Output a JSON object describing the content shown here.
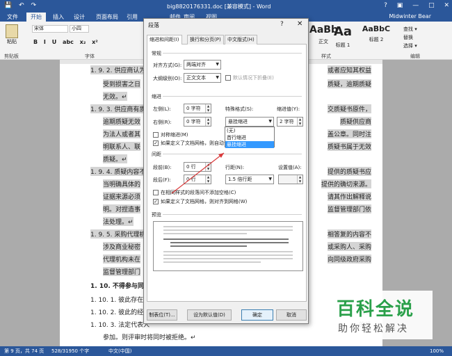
{
  "window": {
    "title": "big8820176331.doc [兼容模式] - Word",
    "quick_access": [
      "💾",
      "↶",
      "↷"
    ],
    "controls": [
      "?",
      "▣",
      "—",
      "□",
      "✕"
    ],
    "user": "Midwinter Bear"
  },
  "ribbon": {
    "file_tab": "文件",
    "tabs": [
      "开始",
      "插入",
      "设计",
      "页面布局",
      "引用",
      "邮件",
      "审阅",
      "视图"
    ],
    "active_tab": "开始",
    "paste_label": "粘贴",
    "clipboard_label": "剪贴板",
    "font_name": "宋体",
    "font_size": "小四",
    "font_group_label": "字体",
    "format_buttons": [
      "B",
      "I",
      "U",
      "abc",
      "x₂",
      "x²"
    ],
    "styles_group_label": "样式",
    "styles": [
      {
        "preview": "AaBb",
        "label": "正文"
      },
      {
        "preview": "Aa",
        "label": "标题 1"
      },
      {
        "preview": "AaBbC",
        "label": "标题 2"
      }
    ],
    "editing": {
      "find": "查找 ▾",
      "replace": "替换",
      "select": "选择 ▾",
      "group_label": "编辑"
    }
  },
  "document": {
    "lines": [
      {
        "text": "1. 9. 2. 供应商认为",
        "right": "或者应知其权益",
        "hl": true
      },
      {
        "text": "受到损害之日",
        "right": "质疑，逾期质疑",
        "hl": true
      },
      {
        "text": "无效。↵",
        "right": "",
        "hl": true
      },
      {
        "text": "1. 9. 3. 供应商有质",
        "right": "交质疑书原件，",
        "hl": true
      },
      {
        "text": "逾期质疑无效",
        "right": "质疑供应商",
        "hl": true
      },
      {
        "text": "为法人或者其",
        "right": "盖公章。同时注",
        "hl": true
      },
      {
        "text": "明联系人、联",
        "right": "质疑书属于无效",
        "hl": true
      },
      {
        "text": "质疑。↵",
        "right": "",
        "hl": true
      },
      {
        "text": "1. 9. 4. 质疑内容不",
        "right": "提供的质疑书应",
        "hl": true
      },
      {
        "text": "当明确具体的",
        "right": "提供的确切来源。",
        "hl": true
      },
      {
        "text": "证据来源必须",
        "right": "请其作出解释说",
        "hl": true
      },
      {
        "text": "明。对捏造事",
        "right": "监督管理部门依",
        "hl": true
      },
      {
        "text": "法处理。↵",
        "right": "",
        "hl": true
      },
      {
        "text": "1. 9. 5. 采购代理机",
        "right": "相答复的内容不",
        "hl": true
      },
      {
        "text": "涉及商业秘密",
        "right": "或采购人、采购",
        "hl": true
      },
      {
        "text": "代理机构未在",
        "right": "向同级政府采购",
        "hl": true
      },
      {
        "text": "监督管理部门",
        "right": "",
        "hl": true
      },
      {
        "text": "1. 10. 不得参与同一",
        "right": "",
        "hl": false
      },
      {
        "text": "1. 10. 1. 彼此存在控",
        "right": "",
        "hl": false
      },
      {
        "text": "1. 10. 2. 彼此的经营",
        "right": "关系",
        "hl": false
      },
      {
        "text": "1. 10. 3. 法定代表人",
        "right": "的投",
        "hl": false
      },
      {
        "text": "参加。则评审时将同时被拒绝。↵",
        "right": "",
        "hl": false
      }
    ]
  },
  "status": {
    "page": "第 9 页，共 74 页",
    "words": "528/31950 个字",
    "lang": "中文(中国)",
    "zoom": "100%"
  },
  "watermark": {
    "title": "百科全说",
    "subtitle": "助你轻松解决"
  },
  "dialog": {
    "title": "段落",
    "help": "?",
    "close": "✕",
    "tabs": [
      "缩进和间距(I)",
      "换行和分页(P)",
      "中文版式(H)"
    ],
    "general": {
      "section": "常规",
      "alignment_label": "对齐方式(G):",
      "alignment_value": "两端对齐",
      "outline_label": "大纲级别(O):",
      "outline_value": "正文文本",
      "collapsed_label": "默认情况下折叠(E)"
    },
    "indent": {
      "section": "缩进",
      "left_label": "左侧(L):",
      "left_value": "0 字符",
      "right_label": "右侧(R):",
      "right_value": "0 字符",
      "special_label": "特殊格式(S):",
      "special_value": "悬挂缩进",
      "indent_value_label": "缩进值(Y):",
      "indent_value": "2 字符",
      "mirror_label": "对称缩进(M)",
      "grid_label": "如果定义了文档网格，则自动调整右缩进(D)",
      "options": [
        "(无)",
        "首行缩进",
        "悬挂缩进"
      ],
      "selected_option": 2
    },
    "spacing": {
      "section": "间距",
      "before_label": "段前(B):",
      "before_value": "0 行",
      "after_label": "段后(F):",
      "after_value": "0 行",
      "line_label": "行距(N):",
      "line_value": "1.5 倍行距",
      "at_label": "设置值(A):",
      "at_value": "",
      "no_space_label": "在相同样式的段落间不添加空格(C)",
      "snap_label": "如果定义了文档网格，则对齐到网格(W)"
    },
    "preview_label": "预览",
    "buttons": {
      "tabs": "制表位(T)...",
      "default": "设为默认值(D)",
      "ok": "确定",
      "cancel": "取消"
    }
  }
}
